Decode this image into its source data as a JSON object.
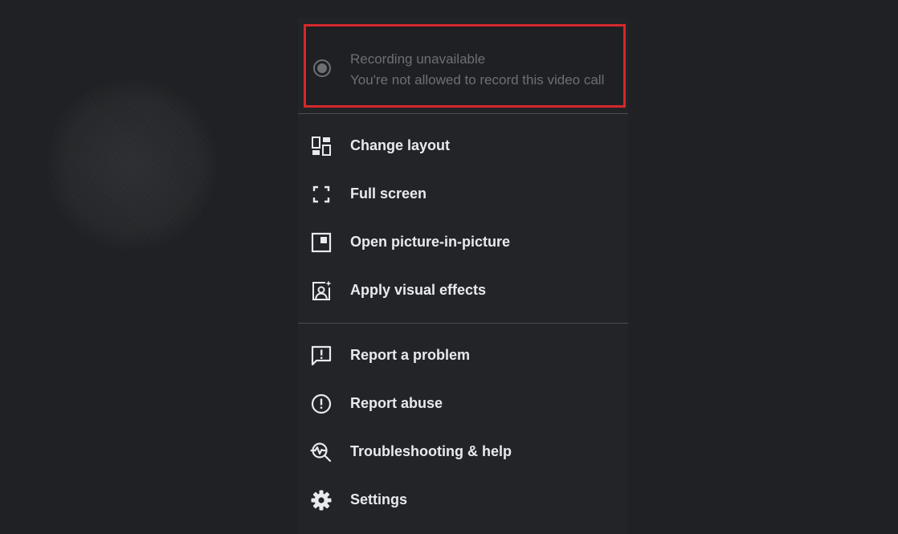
{
  "recording": {
    "title": "Recording unavailable",
    "subtitle": "You're not allowed to record this video call",
    "icon": "record-icon",
    "highlight_color": "#d5282c"
  },
  "menu": {
    "group1": [
      {
        "label": "Change layout",
        "icon": "layout-icon"
      },
      {
        "label": "Full screen",
        "icon": "fullscreen-icon"
      },
      {
        "label": "Open picture-in-picture",
        "icon": "picture-in-picture-icon"
      },
      {
        "label": "Apply visual effects",
        "icon": "visual-effects-icon"
      }
    ],
    "group2": [
      {
        "label": "Report a problem",
        "icon": "feedback-icon"
      },
      {
        "label": "Report abuse",
        "icon": "alert-icon"
      },
      {
        "label": "Troubleshooting & help",
        "icon": "troubleshoot-icon"
      },
      {
        "label": "Settings",
        "icon": "gear-icon"
      }
    ]
  },
  "colors": {
    "background": "#202124",
    "menu_background": "#232427",
    "text": "#e8eaed",
    "disabled_text": "#6d7073"
  }
}
